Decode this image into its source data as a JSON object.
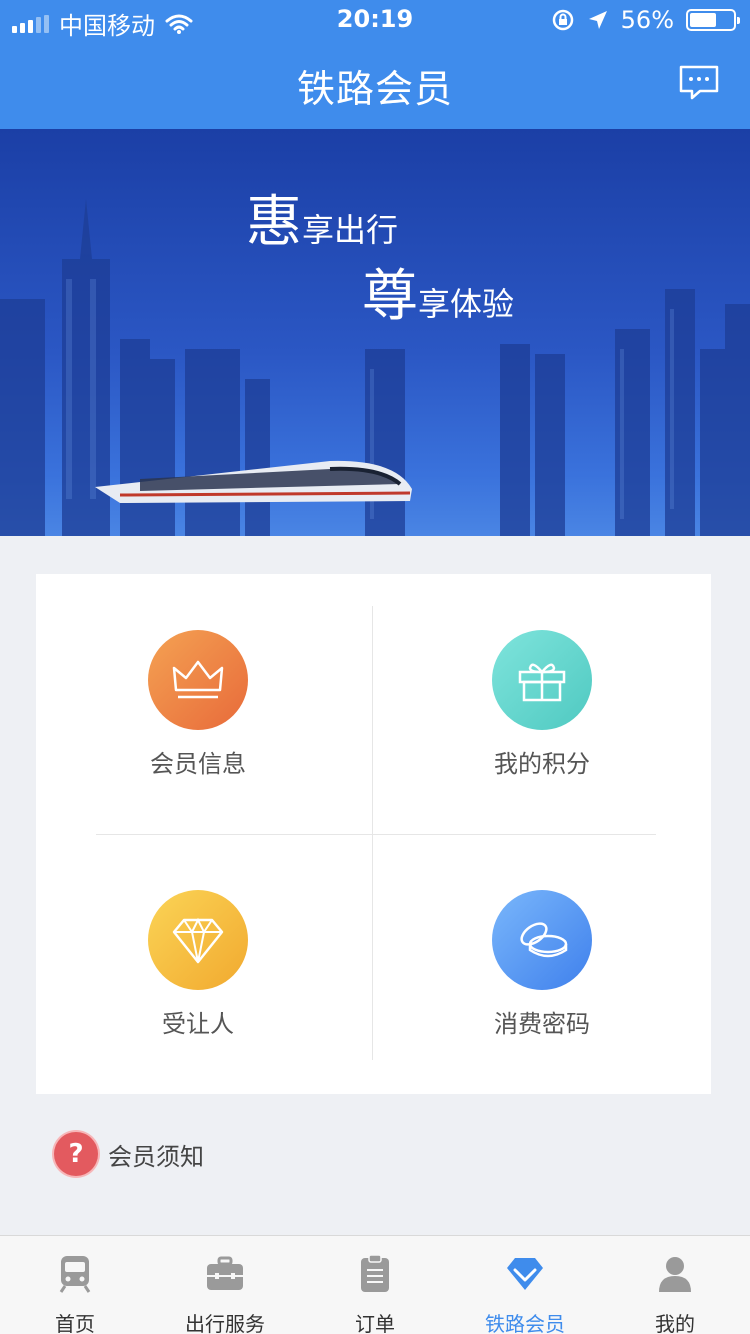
{
  "status_bar": {
    "carrier": "中国移动",
    "time": "20:19",
    "battery": "56%"
  },
  "header": {
    "title": "铁路会员"
  },
  "banner": {
    "line1_big": "惠",
    "line1_rest": "享出行",
    "line2_big": "尊",
    "line2_rest": "享体验"
  },
  "menu": [
    {
      "label": "会员信息",
      "icon": "crown-icon",
      "color": "#e97d42"
    },
    {
      "label": "我的积分",
      "icon": "gift-icon",
      "color": "#5fd3ca"
    },
    {
      "label": "受让人",
      "icon": "diamond-icon",
      "color": "#f4bb3d"
    },
    {
      "label": "消费密码",
      "icon": "coins-icon",
      "color": "#4f8ff0"
    }
  ],
  "notice": {
    "label": "会员须知"
  },
  "tabs": [
    {
      "label": "首页",
      "icon": "train-icon"
    },
    {
      "label": "出行服务",
      "icon": "briefcase-icon"
    },
    {
      "label": "订单",
      "icon": "clipboard-icon"
    },
    {
      "label": "铁路会员",
      "icon": "diamond-icon",
      "active": true
    },
    {
      "label": "我的",
      "icon": "person-icon"
    }
  ],
  "colors": {
    "primary": "#3f8cec",
    "background": "#eef0f4"
  }
}
